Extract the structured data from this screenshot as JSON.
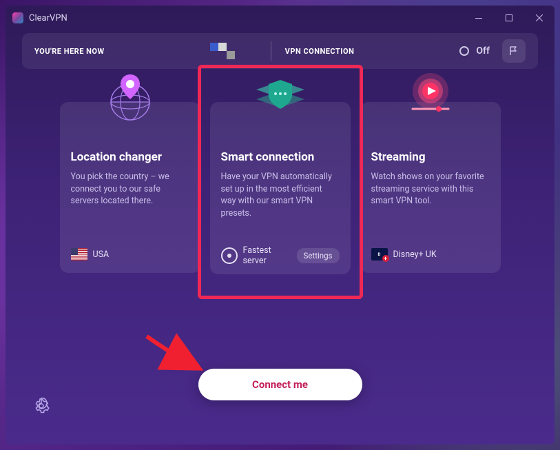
{
  "app": {
    "title": "ClearVPN"
  },
  "topbar": {
    "here_label": "YOU'RE HERE NOW",
    "vpn_label": "VPN CONNECTION",
    "status_text": "Off"
  },
  "cards": {
    "location": {
      "title": "Location changer",
      "desc": "You pick the country – we connect you to our safe servers located there.",
      "footer_text": "USA"
    },
    "smart": {
      "title": "Smart connection",
      "desc": "Have your VPN automatically set up in the most efficient way with our smart VPN presets.",
      "footer_text": "Fastest server",
      "settings_label": "Settings"
    },
    "streaming": {
      "title": "Streaming",
      "desc": "Watch shows on your favorite streaming service with this smart VPN tool.",
      "footer_text": "Disney+ UK"
    }
  },
  "connect_button": "Connect me"
}
